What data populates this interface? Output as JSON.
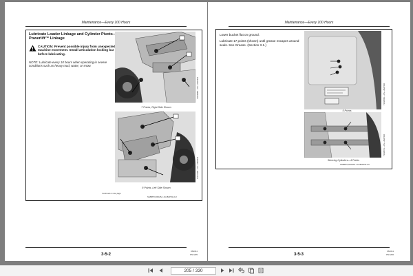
{
  "left_page": {
    "running_head": "Maintenance—Every 100 Hours",
    "title": "Lubricate Loader Linkage and Cylinder Pivots—Powerlift™ Linkage",
    "caution": "CAUTION: Prevent possible injury from unexpected machine movement. Install articulation locking bar before lubricating.",
    "note": "NOTE: Lubricate every 10 hours when operating in severe conditions such as heavy mud, water, or snow.",
    "fig1_caption": "7 Points, Right Side Shown",
    "fig1_id": "T110948B —UN—28APR11",
    "fig2_caption": "8 Points, Left Side Shown",
    "fig2_id": "T110749B —UN—28APR11",
    "continued": "Continued on next page",
    "footer_code": "NA88870,000A25A -19-28APR11-1/2",
    "page_number": "3-5-2",
    "edition_code": "061011",
    "pn_code": "PN=205"
  },
  "right_page": {
    "running_head": "Maintenance—Every 100 Hours",
    "text1": "Lower bucket flat on ground.",
    "text2": "Lubricate 17 points (shown) until grease escapes around seals. See Grease. (Section 3-1.)",
    "fig1_caption": "5 Points",
    "fig1_id": "T123456A —UN—28APR11",
    "fig2_caption": "Steering Cylinders—4 Points",
    "fig2_id": "T123457A —UN—28APR11",
    "footer_code": "NA88870,000A25A -19-28APR11-2/2",
    "page_number": "3-5-3",
    "edition_code": "061011",
    "pn_code": "PN=206"
  },
  "toolbar": {
    "first_icon": "first-page-icon",
    "prev_icon": "previous-page-icon",
    "page_field": "205 / 330",
    "next_icon": "next-page-icon",
    "last_icon": "last-page-icon",
    "back_icon": "back-icon",
    "copy_icon": "copy-icon",
    "extra_icon": "pages-icon"
  }
}
